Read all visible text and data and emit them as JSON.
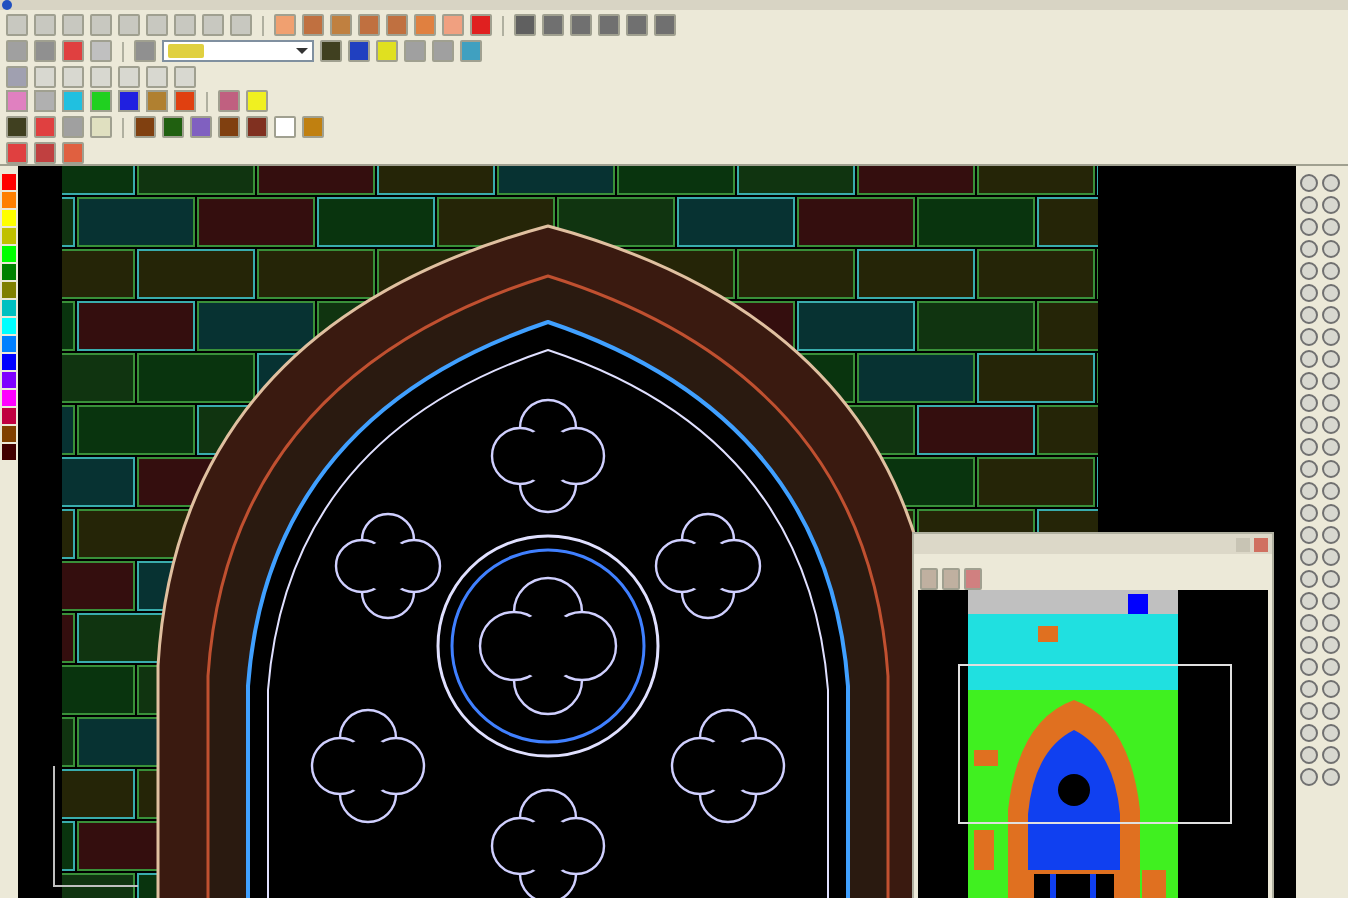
{
  "palette": [
    {
      "color": "#ff0000"
    },
    {
      "color": "#ff8000"
    },
    {
      "color": "#ffff00"
    },
    {
      "color": "#c0c000"
    },
    {
      "color": "#00ff00"
    },
    {
      "color": "#008000"
    },
    {
      "color": "#808000"
    },
    {
      "color": "#00c0c0"
    },
    {
      "color": "#00ffff"
    },
    {
      "color": "#0080ff"
    },
    {
      "color": "#0000ff"
    },
    {
      "color": "#8000ff"
    },
    {
      "color": "#ff00ff"
    },
    {
      "color": "#c00040"
    },
    {
      "color": "#804000"
    },
    {
      "color": "#400000"
    }
  ],
  "color_swatches": [
    {
      "color": "#e080c0"
    },
    {
      "color": "#b0b0b0"
    },
    {
      "color": "#20c0e0"
    },
    {
      "color": "#20d020"
    },
    {
      "color": "#2020e0"
    },
    {
      "color": "#b08030"
    },
    {
      "color": "#e04010"
    }
  ]
}
